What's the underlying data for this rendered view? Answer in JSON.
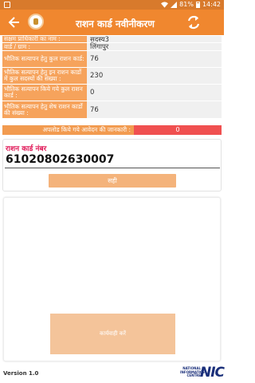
{
  "status_bar": {
    "battery": "81%",
    "time": "14:42"
  },
  "app_bar": {
    "title": "राशन कार्ड नवीनीकरण"
  },
  "info": [
    {
      "label": "सक्षम प्राधिकारी का नाम :",
      "value": "सदस्य3"
    },
    {
      "label": "वार्ड / ग्राम :",
      "value": "लिंगापुर"
    },
    {
      "label": "भौतिक सत्यापन हेतु कुल राशन कार्ड:",
      "value": "76"
    },
    {
      "label": "भौतिक सत्यापन हेतु इन राशन कार्डो में कुल सदस्यों की संख्या :",
      "value": "230"
    },
    {
      "label": "भौतिक सत्यापन किये गये कुल राशन कार्ड :",
      "value": "0"
    },
    {
      "label": "भौतिक सत्यापन हेतु शेष राशन कार्डो की संख्या :",
      "value": "76"
    }
  ],
  "upload": {
    "label": "अपलोड किये गये आवेदन की जानकारी :",
    "count": "0"
  },
  "card_number": {
    "label": "राशन कार्ड नंबर",
    "value": "61020802630007"
  },
  "submit": {
    "label": "सही"
  },
  "action": {
    "label": "कार्यवाही करें"
  },
  "footer": {
    "version": "Version 1.0",
    "nic_small": "NATIONAL INFORMATICS CENTRE",
    "nic_big": "NIC"
  },
  "colors": {
    "status_bar": "#d87a2c",
    "app_bar": "#f0872f",
    "label_bg": "#f6a35c",
    "badge": "#f05050",
    "card_label": "#e01c5a"
  }
}
